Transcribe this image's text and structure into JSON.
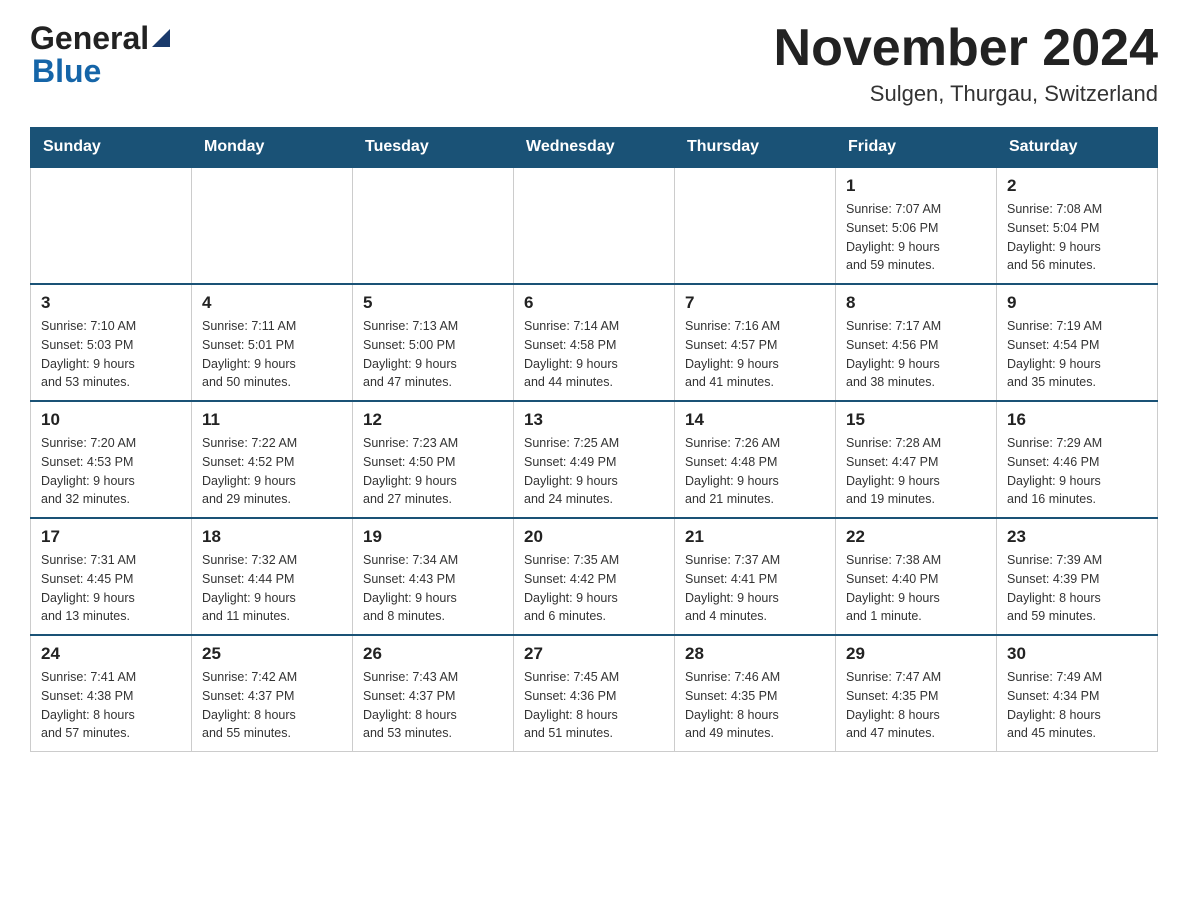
{
  "header": {
    "logo": {
      "general": "General",
      "blue": "Blue"
    },
    "title": "November 2024",
    "location": "Sulgen, Thurgau, Switzerland"
  },
  "calendar": {
    "days_of_week": [
      "Sunday",
      "Monday",
      "Tuesday",
      "Wednesday",
      "Thursday",
      "Friday",
      "Saturday"
    ],
    "weeks": [
      [
        {
          "day": "",
          "info": ""
        },
        {
          "day": "",
          "info": ""
        },
        {
          "day": "",
          "info": ""
        },
        {
          "day": "",
          "info": ""
        },
        {
          "day": "",
          "info": ""
        },
        {
          "day": "1",
          "info": "Sunrise: 7:07 AM\nSunset: 5:06 PM\nDaylight: 9 hours\nand 59 minutes."
        },
        {
          "day": "2",
          "info": "Sunrise: 7:08 AM\nSunset: 5:04 PM\nDaylight: 9 hours\nand 56 minutes."
        }
      ],
      [
        {
          "day": "3",
          "info": "Sunrise: 7:10 AM\nSunset: 5:03 PM\nDaylight: 9 hours\nand 53 minutes."
        },
        {
          "day": "4",
          "info": "Sunrise: 7:11 AM\nSunset: 5:01 PM\nDaylight: 9 hours\nand 50 minutes."
        },
        {
          "day": "5",
          "info": "Sunrise: 7:13 AM\nSunset: 5:00 PM\nDaylight: 9 hours\nand 47 minutes."
        },
        {
          "day": "6",
          "info": "Sunrise: 7:14 AM\nSunset: 4:58 PM\nDaylight: 9 hours\nand 44 minutes."
        },
        {
          "day": "7",
          "info": "Sunrise: 7:16 AM\nSunset: 4:57 PM\nDaylight: 9 hours\nand 41 minutes."
        },
        {
          "day": "8",
          "info": "Sunrise: 7:17 AM\nSunset: 4:56 PM\nDaylight: 9 hours\nand 38 minutes."
        },
        {
          "day": "9",
          "info": "Sunrise: 7:19 AM\nSunset: 4:54 PM\nDaylight: 9 hours\nand 35 minutes."
        }
      ],
      [
        {
          "day": "10",
          "info": "Sunrise: 7:20 AM\nSunset: 4:53 PM\nDaylight: 9 hours\nand 32 minutes."
        },
        {
          "day": "11",
          "info": "Sunrise: 7:22 AM\nSunset: 4:52 PM\nDaylight: 9 hours\nand 29 minutes."
        },
        {
          "day": "12",
          "info": "Sunrise: 7:23 AM\nSunset: 4:50 PM\nDaylight: 9 hours\nand 27 minutes."
        },
        {
          "day": "13",
          "info": "Sunrise: 7:25 AM\nSunset: 4:49 PM\nDaylight: 9 hours\nand 24 minutes."
        },
        {
          "day": "14",
          "info": "Sunrise: 7:26 AM\nSunset: 4:48 PM\nDaylight: 9 hours\nand 21 minutes."
        },
        {
          "day": "15",
          "info": "Sunrise: 7:28 AM\nSunset: 4:47 PM\nDaylight: 9 hours\nand 19 minutes."
        },
        {
          "day": "16",
          "info": "Sunrise: 7:29 AM\nSunset: 4:46 PM\nDaylight: 9 hours\nand 16 minutes."
        }
      ],
      [
        {
          "day": "17",
          "info": "Sunrise: 7:31 AM\nSunset: 4:45 PM\nDaylight: 9 hours\nand 13 minutes."
        },
        {
          "day": "18",
          "info": "Sunrise: 7:32 AM\nSunset: 4:44 PM\nDaylight: 9 hours\nand 11 minutes."
        },
        {
          "day": "19",
          "info": "Sunrise: 7:34 AM\nSunset: 4:43 PM\nDaylight: 9 hours\nand 8 minutes."
        },
        {
          "day": "20",
          "info": "Sunrise: 7:35 AM\nSunset: 4:42 PM\nDaylight: 9 hours\nand 6 minutes."
        },
        {
          "day": "21",
          "info": "Sunrise: 7:37 AM\nSunset: 4:41 PM\nDaylight: 9 hours\nand 4 minutes."
        },
        {
          "day": "22",
          "info": "Sunrise: 7:38 AM\nSunset: 4:40 PM\nDaylight: 9 hours\nand 1 minute."
        },
        {
          "day": "23",
          "info": "Sunrise: 7:39 AM\nSunset: 4:39 PM\nDaylight: 8 hours\nand 59 minutes."
        }
      ],
      [
        {
          "day": "24",
          "info": "Sunrise: 7:41 AM\nSunset: 4:38 PM\nDaylight: 8 hours\nand 57 minutes."
        },
        {
          "day": "25",
          "info": "Sunrise: 7:42 AM\nSunset: 4:37 PM\nDaylight: 8 hours\nand 55 minutes."
        },
        {
          "day": "26",
          "info": "Sunrise: 7:43 AM\nSunset: 4:37 PM\nDaylight: 8 hours\nand 53 minutes."
        },
        {
          "day": "27",
          "info": "Sunrise: 7:45 AM\nSunset: 4:36 PM\nDaylight: 8 hours\nand 51 minutes."
        },
        {
          "day": "28",
          "info": "Sunrise: 7:46 AM\nSunset: 4:35 PM\nDaylight: 8 hours\nand 49 minutes."
        },
        {
          "day": "29",
          "info": "Sunrise: 7:47 AM\nSunset: 4:35 PM\nDaylight: 8 hours\nand 47 minutes."
        },
        {
          "day": "30",
          "info": "Sunrise: 7:49 AM\nSunset: 4:34 PM\nDaylight: 8 hours\nand 45 minutes."
        }
      ]
    ]
  }
}
